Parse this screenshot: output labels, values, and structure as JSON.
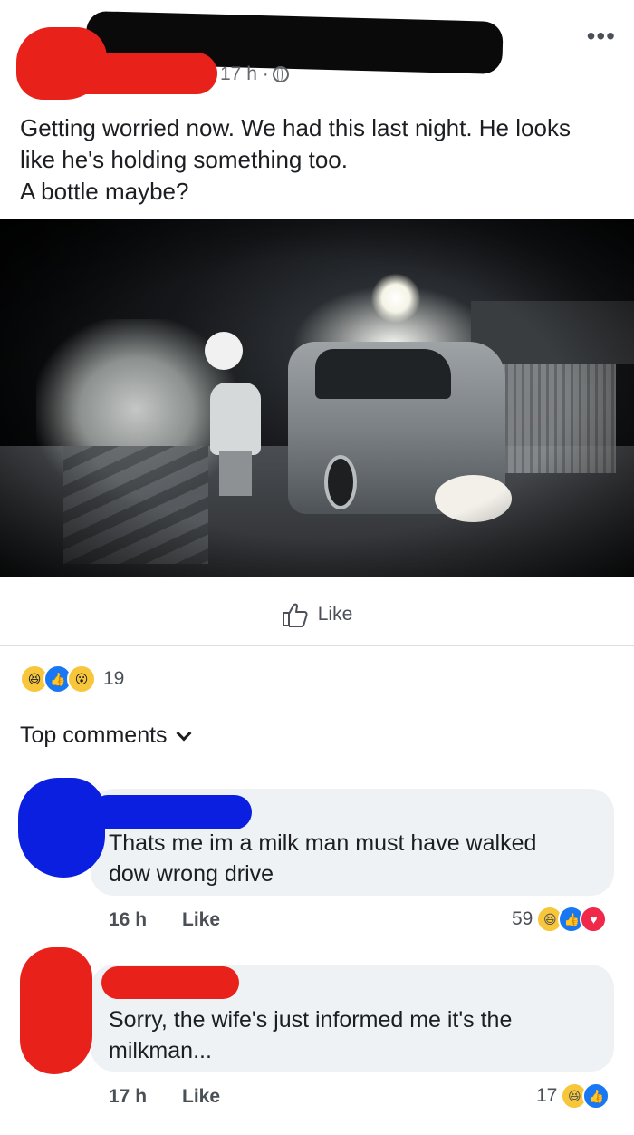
{
  "post": {
    "time": "17 h ·",
    "more_label": "•••",
    "text": "Getting worried now. We had this last night. He looks\nlike he's holding something too.\nA bottle maybe?"
  },
  "actions": {
    "like_label": "Like"
  },
  "reactions": {
    "icons": [
      "haha-icon",
      "like-icon",
      "wow-icon"
    ],
    "count": "19"
  },
  "comments_section": {
    "filter_label": "Top comments"
  },
  "comments": [
    {
      "text": "Thats me im a milk man must have walked\ndow wrong drive",
      "time": "16 h",
      "like_label": "Like",
      "reaction_count": "59",
      "reaction_icons": [
        "haha-icon",
        "like-icon",
        "heart-icon"
      ]
    },
    {
      "text": "Sorry, the wife's just informed me it's the\nmilkman...",
      "time": "17 h",
      "like_label": "Like",
      "reaction_count": "17",
      "reaction_icons": [
        "haha-icon",
        "like-icon"
      ]
    }
  ],
  "colors": {
    "like_blue": "#1877f2",
    "redaction_red": "#e8221a",
    "redaction_blue": "#0a1fe0",
    "bubble_bg": "#eff2f5"
  }
}
